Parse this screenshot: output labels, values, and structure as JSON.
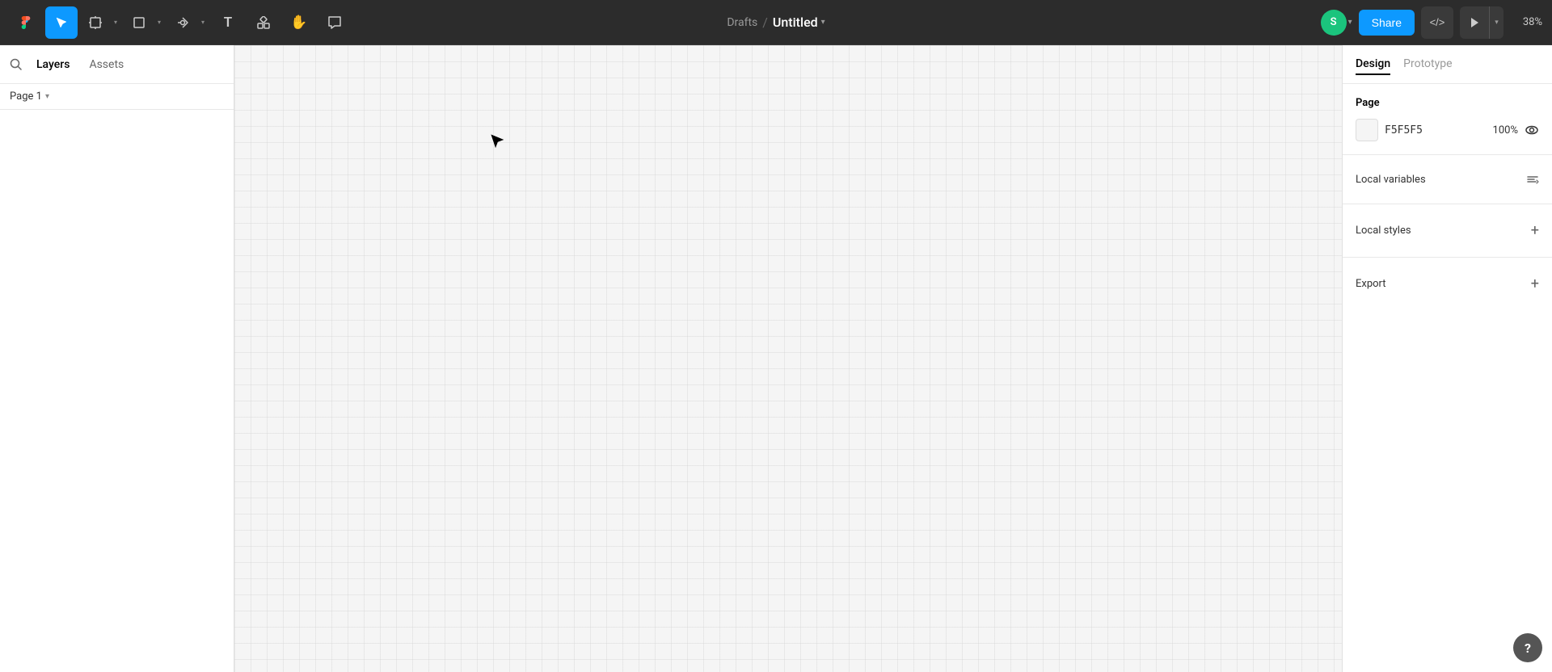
{
  "toolbar": {
    "logo_label": "figma-logo",
    "tools": [
      {
        "name": "select-tool",
        "label": "Select",
        "icon": "▲",
        "active": true,
        "has_arrow": false
      },
      {
        "name": "frame-tool",
        "label": "Frame",
        "icon": "⊞",
        "active": false,
        "has_arrow": true
      },
      {
        "name": "shape-tool",
        "label": "Shape",
        "icon": "□",
        "active": false,
        "has_arrow": true
      },
      {
        "name": "pen-tool",
        "label": "Pen",
        "icon": "✒",
        "active": false,
        "has_arrow": true
      },
      {
        "name": "text-tool",
        "label": "Text",
        "icon": "T",
        "active": false,
        "has_arrow": false
      },
      {
        "name": "components-tool",
        "label": "Components",
        "icon": "⁜",
        "active": false,
        "has_arrow": false
      },
      {
        "name": "hand-tool",
        "label": "Hand",
        "icon": "✋",
        "active": false,
        "has_arrow": false
      },
      {
        "name": "comment-tool",
        "label": "Comment",
        "icon": "💬",
        "active": false,
        "has_arrow": false
      }
    ],
    "breadcrumb": {
      "drafts": "Drafts",
      "separator": "/",
      "title": "Untitled",
      "chevron": "▾"
    },
    "avatar": {
      "initial": "S",
      "color": "#1bc47d"
    },
    "share_label": "Share",
    "zoom_level": "38%"
  },
  "left_panel": {
    "search_icon": "🔍",
    "tabs": [
      {
        "name": "layers-tab",
        "label": "Layers",
        "active": true
      },
      {
        "name": "assets-tab",
        "label": "Assets",
        "active": false
      }
    ],
    "page_selector": {
      "label": "Page 1",
      "chevron": "▾"
    }
  },
  "canvas": {
    "background_color": "#f5f5f5"
  },
  "right_panel": {
    "tabs": [
      {
        "name": "design-tab",
        "label": "Design",
        "active": true
      },
      {
        "name": "prototype-tab",
        "label": "Prototype",
        "active": false
      }
    ],
    "sections": {
      "page": {
        "title": "Page",
        "bg_color_hex": "F5F5F5",
        "bg_opacity": "100%",
        "visibility_icon": "👁"
      },
      "local_variables": {
        "title": "Local variables"
      },
      "local_styles": {
        "title": "Local styles",
        "add_icon": "+"
      },
      "export": {
        "title": "Export",
        "add_icon": "+"
      }
    }
  },
  "help": {
    "label": "?"
  }
}
